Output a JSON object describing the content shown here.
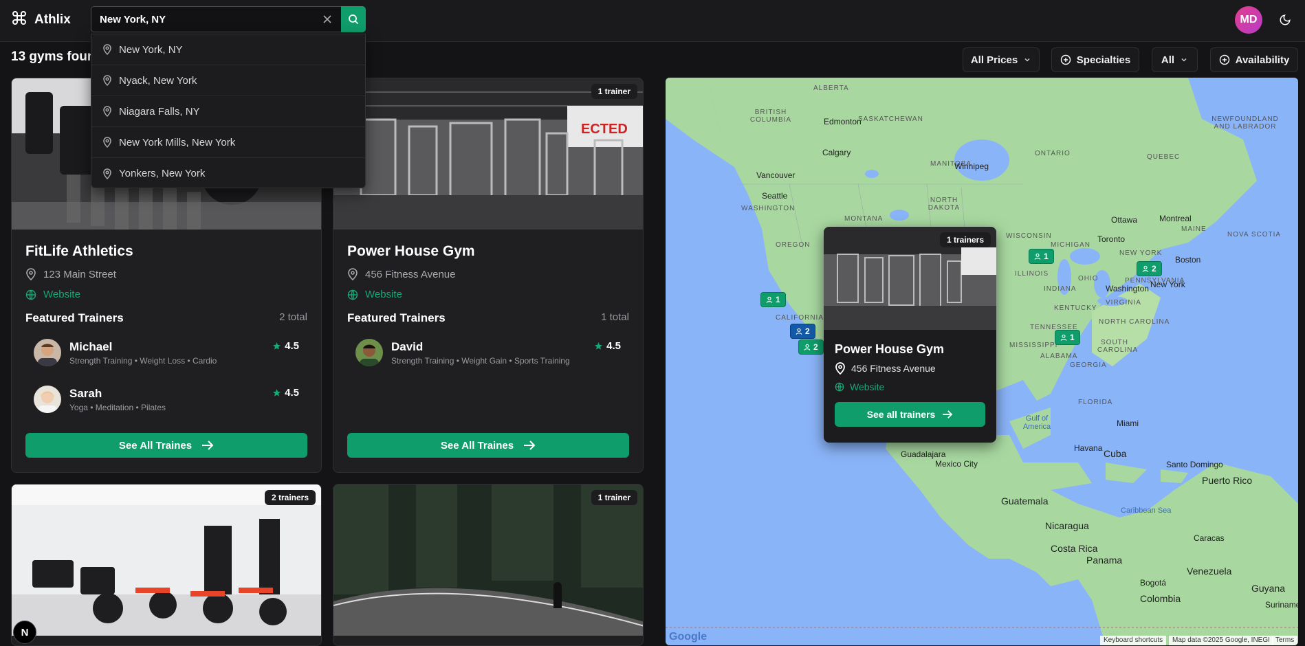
{
  "app": {
    "name": "Athlix"
  },
  "search": {
    "value": "New York, NY",
    "suggestions": [
      "New York, NY",
      "Nyack, New York",
      "Niagara Falls, NY",
      "New York Mills, New York",
      "Yonkers, New York"
    ]
  },
  "user": {
    "initials": "MD"
  },
  "results": {
    "count_text": "13 gyms found"
  },
  "filters": {
    "prices": "All Prices",
    "specialties": "Specialties",
    "all": "All",
    "availability": "Availability"
  },
  "gyms": [
    {
      "name": "FitLife Athletics",
      "address": "123 Main Street",
      "website": "Website",
      "featured": "Featured Trainers",
      "total": "2 total",
      "trainers": [
        {
          "name": "Michael",
          "specialties": "Strength Training • Weight Loss • Cardio",
          "rating": "4.5"
        },
        {
          "name": "Sarah",
          "specialties": "Yoga • Meditation • Pilates",
          "rating": "4.5"
        }
      ],
      "cta": "See All Traines"
    },
    {
      "name": "Power House Gym",
      "address": "456 Fitness Avenue",
      "website": "Website",
      "featured": "Featured Trainers",
      "total": "1 total",
      "badge": "1 trainer",
      "trainers": [
        {
          "name": "David",
          "specialties": "Strength Training • Weight Gain • Sports Training",
          "rating": "4.5"
        }
      ],
      "cta": "See All Traines"
    },
    {
      "badge": "2 trainers"
    },
    {
      "badge": "1 trainer"
    }
  ],
  "map": {
    "popup": {
      "badge": "1 trainers",
      "name": "Power House Gym",
      "address": "456 Fitness Avenue",
      "website": "Website",
      "cta": "See all trainers"
    },
    "markers": [
      "1",
      "2",
      "2",
      "1",
      "1",
      "2",
      "1"
    ],
    "regions": [
      "ALBERTA",
      "BRITISH COLUMBIA",
      "SASKATCHEWAN",
      "MANITOBA",
      "ONTARIO",
      "QUEBEC",
      "NEWFOUNDLAND AND LABRADOR",
      "WASHINGTON",
      "OREGON",
      "MONTANA",
      "NORTH DAKOTA",
      "CALIFORNIA",
      "WISCONSIN",
      "MICHIGAN",
      "ILLINOIS",
      "OHIO",
      "NEW YORK",
      "MAINE",
      "NOVA SCOTIA",
      "TENNESSEE",
      "MISSISSIPPI",
      "ALABAMA",
      "GEORGIA",
      "SOUTH CAROLINA",
      "NORTH CAROLINA",
      "VIRGINIA",
      "KENTUCKY",
      "INDIANA",
      "PENNSYLVANIA",
      "FLORIDA"
    ],
    "cities": [
      "Edmonton",
      "Calgary",
      "Vancouver",
      "Seattle",
      "Winnipeg",
      "Ottawa",
      "Montreal",
      "Toronto",
      "Boston",
      "New York",
      "Washington",
      "Miami",
      "Havana",
      "Cuba",
      "Guadalajara",
      "Mexico City",
      "Guatemala",
      "Nicaragua",
      "Costa Rica",
      "Panama",
      "Santo Domingo",
      "Puerto Rico",
      "Caracas",
      "Venezuela",
      "Bogotá",
      "Colombia",
      "Guyana",
      "Suriname"
    ],
    "water": [
      "Gulf of America",
      "Caribbean Sea"
    ],
    "attribution": {
      "shortcuts": "Keyboard shortcuts",
      "data": "Map data ©2025 Google, INEGI",
      "terms": "Terms",
      "brand": "Google"
    }
  }
}
